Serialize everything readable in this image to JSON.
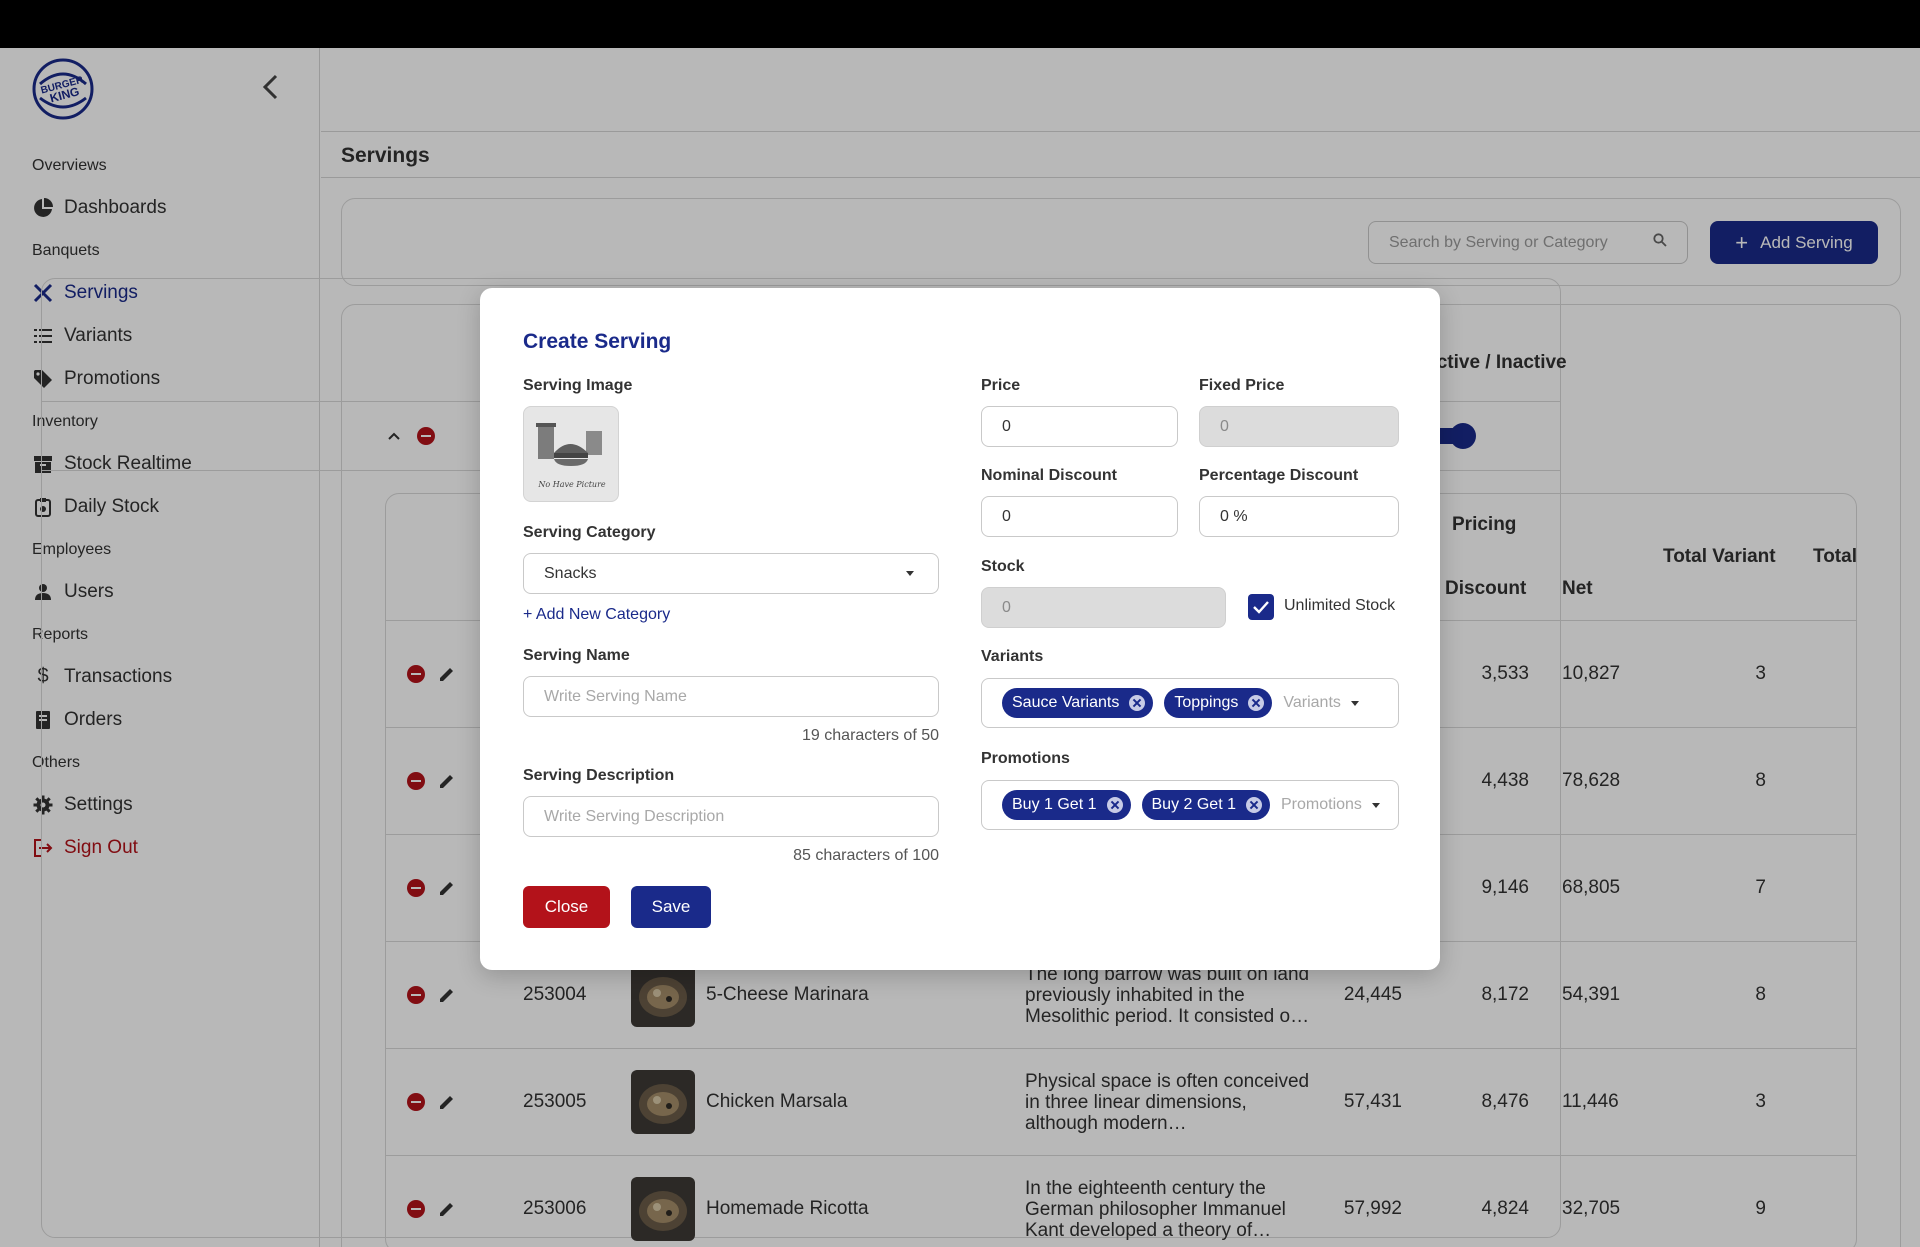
{
  "sidebar": {
    "logo_text": "BURGER KING",
    "sections": [
      {
        "title": "Overviews",
        "items": [
          {
            "label": "Dashboards",
            "icon": "pie-chart-icon"
          }
        ]
      },
      {
        "title": "Banquets",
        "items": [
          {
            "label": "Servings",
            "icon": "utensils-icon",
            "active": true
          },
          {
            "label": "Variants",
            "icon": "list-icon"
          },
          {
            "label": "Promotions",
            "icon": "tag-icon"
          }
        ]
      },
      {
        "title": "Inventory",
        "items": [
          {
            "label": "Stock Realtime",
            "icon": "archive-icon"
          },
          {
            "label": "Daily Stock",
            "icon": "clipboard-icon"
          }
        ]
      },
      {
        "title": "Employees",
        "items": [
          {
            "label": "Users",
            "icon": "user-icon"
          }
        ]
      },
      {
        "title": "Reports",
        "items": [
          {
            "label": "Transactions",
            "icon": "dollar-icon"
          },
          {
            "label": "Orders",
            "icon": "receipt-icon"
          }
        ]
      },
      {
        "title": "Others",
        "items": [
          {
            "label": "Settings",
            "icon": "gear-icon"
          },
          {
            "label": "Sign Out",
            "icon": "sign-out-icon"
          }
        ]
      }
    ]
  },
  "page": {
    "title": "Servings",
    "search_placeholder": "Search by Serving or Category",
    "add_button": "Add Serving"
  },
  "outer_table": {
    "header_active": "Active / Inactive",
    "active": true
  },
  "inner_table": {
    "headers": {
      "pricing": "Pricing",
      "discount": "Discount",
      "net": "Net",
      "total_variant": "Total Variant",
      "total": "Total"
    },
    "rows": [
      {
        "id": "",
        "name": "",
        "description": "",
        "price": "",
        "discount": "3,533",
        "net": "10,827",
        "total_variant": "3",
        "image": "none"
      },
      {
        "id": "",
        "name": "",
        "description": "",
        "price": "",
        "discount": "4,438",
        "net": "78,628",
        "total_variant": "8",
        "image": "none"
      },
      {
        "id": "",
        "name": "",
        "description": "",
        "price": "",
        "discount": "9,146",
        "net": "68,805",
        "total_variant": "7",
        "image": "none"
      },
      {
        "id": "253004",
        "name": "5-Cheese Marinara",
        "description": "The long barrow was built on land previously inhabited in the Mesolithic period. It consisted o…",
        "price": "24,445",
        "discount": "8,172",
        "net": "54,391",
        "total_variant": "8",
        "image": "food-photo"
      },
      {
        "id": "253005",
        "name": "Chicken Marsala",
        "description": "Physical space is often conceived in three linear dimensions, although modern…",
        "price": "57,431",
        "discount": "8,476",
        "net": "11,446",
        "total_variant": "3",
        "image": "food-photo"
      },
      {
        "id": "253006",
        "name": "Homemade Ricotta",
        "description": "In the eighteenth century the German philosopher Immanuel Kant developed a theory of…",
        "price": "57,992",
        "discount": "4,824",
        "net": "32,705",
        "total_variant": "9",
        "image": "food-photo"
      }
    ]
  },
  "modal": {
    "title": "Create Serving",
    "image_label": "Serving Image",
    "image_placeholder": "No Have Picture",
    "category_label": "Serving Category",
    "category_value": "Snacks",
    "add_category_link": "+ Add New Category",
    "name_label": "Serving Name",
    "name_placeholder": "Write Serving Name",
    "name_counter": "19 characters of 50",
    "desc_label": "Serving Description",
    "desc_placeholder": "Write Serving Description",
    "desc_counter": "85 characters of 100",
    "price_label": "Price",
    "price_value": "0",
    "fixed_price_label": "Fixed Price",
    "fixed_price_value": "0",
    "nominal_discount_label": "Nominal Discount",
    "nominal_discount_value": "0",
    "percentage_discount_label": "Percentage Discount",
    "percentage_discount_value": "0 %",
    "stock_label": "Stock",
    "stock_value": "0",
    "unlimited_stock_label": "Unlimited Stock",
    "unlimited_stock_checked": true,
    "variants_label": "Variants",
    "variants": [
      "Sauce Variants",
      "Toppings"
    ],
    "variants_placeholder": "Variants",
    "promotions_label": "Promotions",
    "promotions": [
      "Buy 1 Get 1",
      "Buy 2 Get 1"
    ],
    "promotions_placeholder": "Promotions",
    "close_button": "Close",
    "save_button": "Save"
  },
  "colors": {
    "primary": "#1a2a8a",
    "danger": "#b3121a"
  }
}
